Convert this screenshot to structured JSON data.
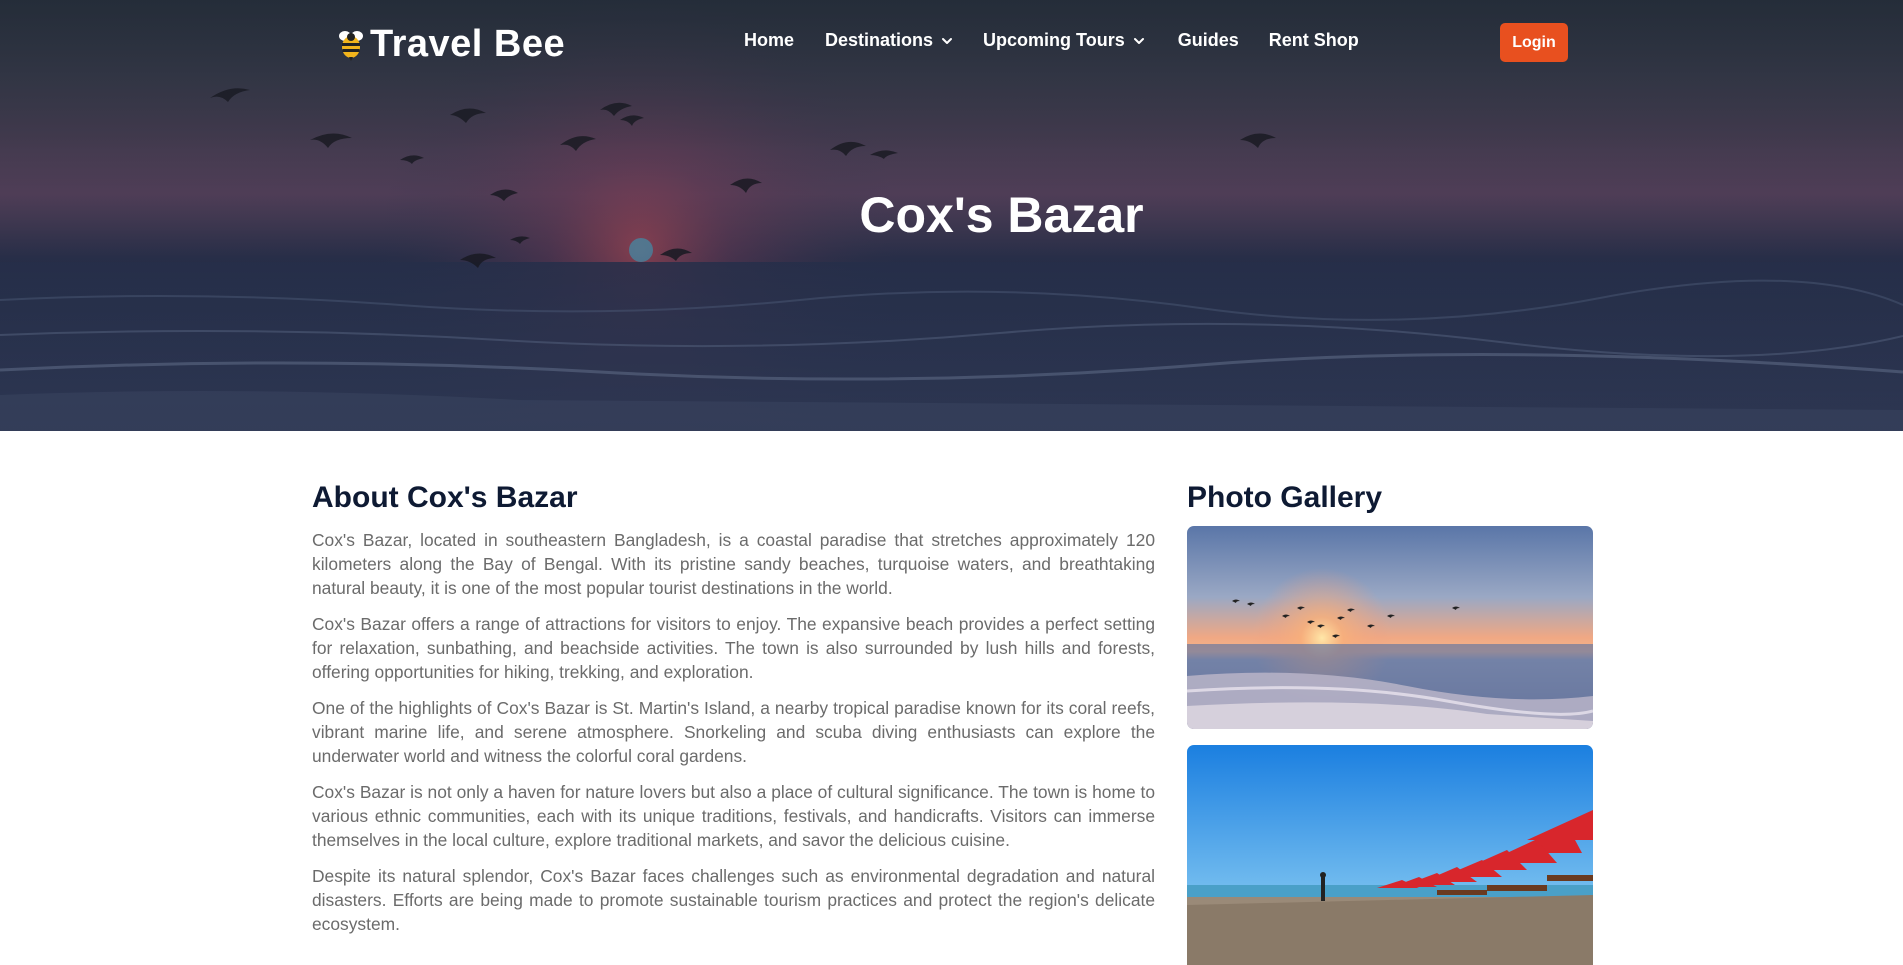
{
  "nav": {
    "brand": "Travel Bee",
    "items": [
      {
        "label": "Home",
        "has_dropdown": false
      },
      {
        "label": "Destinations",
        "has_dropdown": true
      },
      {
        "label": "Upcoming Tours",
        "has_dropdown": true
      },
      {
        "label": "Guides",
        "has_dropdown": false
      },
      {
        "label": "Rent Shop",
        "has_dropdown": false
      }
    ],
    "login_label": "Login"
  },
  "hero": {
    "title": "Cox's Bazar"
  },
  "about": {
    "heading": "About Cox's Bazar",
    "paragraphs": [
      "Cox's Bazar, located in southeastern Bangladesh, is a coastal paradise that stretches approximately 120 kilometers along the Bay of Bengal. With its pristine sandy beaches, turquoise waters, and breathtaking natural beauty, it is one of the most popular tourist destinations in the world.",
      "Cox's Bazar offers a range of attractions for visitors to enjoy. The expansive beach provides a perfect setting for relaxation, sunbathing, and beachside activities. The town is also surrounded by lush hills and forests, offering opportunities for hiking, trekking, and exploration.",
      "One of the highlights of Cox's Bazar is St. Martin's Island, a nearby tropical paradise known for its coral reefs, vibrant marine life, and serene atmosphere. Snorkeling and scuba diving enthusiasts can explore the underwater world and witness the colorful coral gardens.",
      "Cox's Bazar is not only a haven for nature lovers but also a place of cultural significance. The town is home to various ethnic communities, each with its unique traditions, festivals, and handicrafts. Visitors can immerse themselves in the local culture, explore traditional markets, and savor the delicious cuisine.",
      "Despite its natural splendor, Cox's Bazar faces challenges such as environmental degradation and natural disasters. Efforts are being made to promote sustainable tourism practices and protect the region's delicate ecosystem."
    ]
  },
  "gallery": {
    "heading": "Photo Gallery"
  },
  "colors": {
    "accent": "#e8501f",
    "heading": "#0e1a33",
    "body_text": "#6b6b6b"
  }
}
